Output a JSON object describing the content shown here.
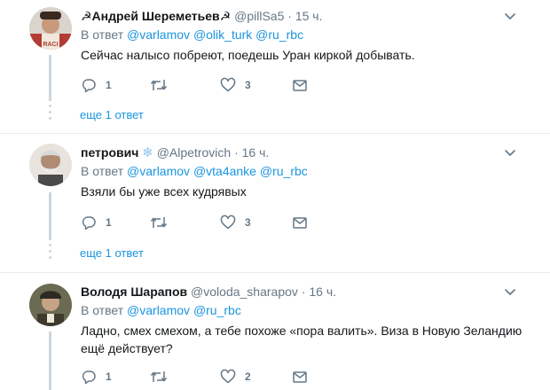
{
  "tweets": [
    {
      "name": "☭Андрей Шереметьев☭",
      "handle": "@pillSa5",
      "time": "15 ч.",
      "reply_prefix": "В ответ",
      "reply_to": [
        "@varlamov",
        "@olik_turk",
        "@ru_rbc"
      ],
      "text": "Сейчас налысо побреют, поедешь Уран киркой добывать.",
      "replies": "1",
      "retweets": "",
      "likes": "3",
      "more": "еще 1 ответ"
    },
    {
      "name": "петрович",
      "badge": "❄",
      "handle": "@Alpetrovich",
      "time": "16 ч.",
      "reply_prefix": "В ответ",
      "reply_to": [
        "@varlamov",
        "@vta4anke",
        "@ru_rbc"
      ],
      "text": "Взяли бы уже всех кудрявых",
      "replies": "1",
      "retweets": "",
      "likes": "3",
      "more": "еще 1 ответ"
    },
    {
      "name": "Володя Шарапов",
      "handle": "@voloda_sharapov",
      "time": "16 ч.",
      "reply_prefix": "В ответ",
      "reply_to": [
        "@varlamov",
        "@ru_rbc"
      ],
      "text": "Ладно, смех смехом, а тебе похоже «пора валить». Виза в Новую Зеландию ещё действует?",
      "replies": "1",
      "retweets": "",
      "likes": "2",
      "more": ""
    }
  ],
  "icons": {
    "reply": "reply-icon",
    "retweet": "retweet-icon",
    "like": "heart-icon",
    "dm": "envelope-icon",
    "caret": "chevron-down-icon"
  },
  "colors": {
    "link": "#1b95e0",
    "muted": "#657786",
    "text": "#14171a",
    "separator": "#e6ecf0",
    "thread": "#cdd6dd"
  }
}
